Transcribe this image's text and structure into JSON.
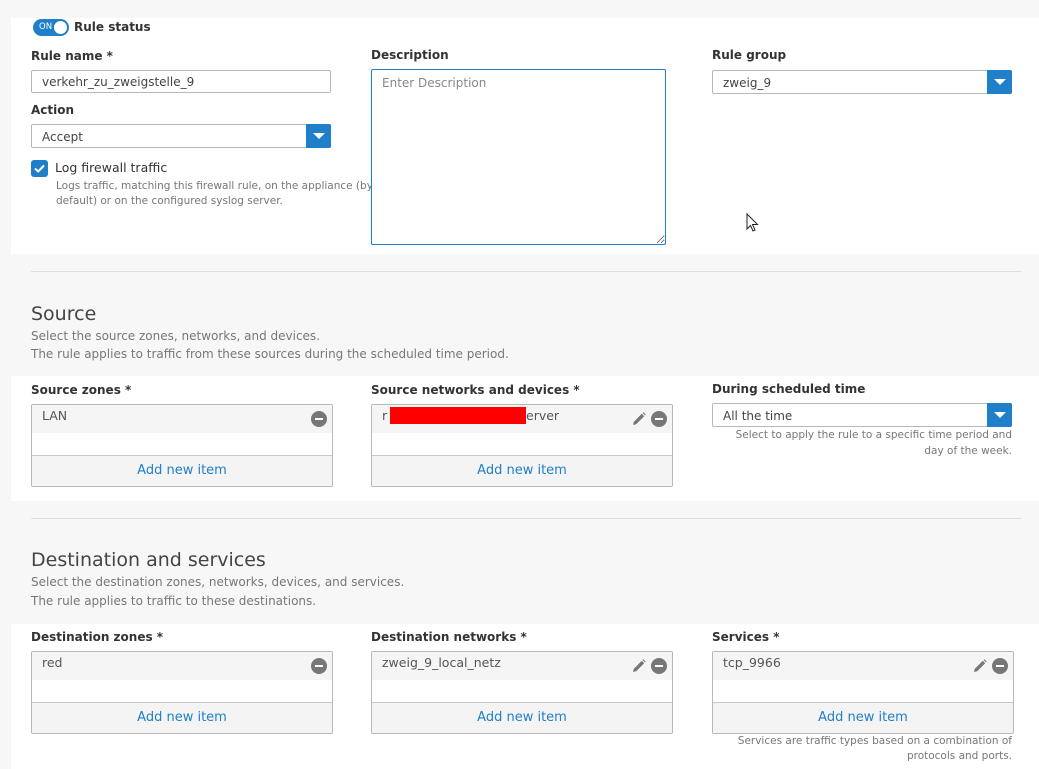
{
  "rule": {
    "status_toggle": "ON",
    "status_label": "Rule status",
    "name_label": "Rule name *",
    "name_value": "verkehr_zu_zweigstelle_9",
    "action_label": "Action",
    "action_value": "Accept",
    "log_label": "Log firewall traffic",
    "log_hint_line1": "Logs traffic, matching this firewall rule, on the appliance (by",
    "log_hint_line2": "default) or on the configured syslog server.",
    "description_label": "Description",
    "description_placeholder": "Enter Description",
    "group_label": "Rule group",
    "group_value": "zweig_9"
  },
  "source": {
    "title": "Source",
    "desc_line1": "Select the source zones, networks, and devices.",
    "desc_line2": "The rule applies to traffic from these sources during the scheduled time period.",
    "zones_label": "Source zones *",
    "zones_item": "LAN",
    "networks_label": "Source networks and devices *",
    "networks_item_start": "r",
    "networks_item_end": "erver",
    "schedule_label": "During scheduled time",
    "schedule_value": "All the time",
    "schedule_hint_line1": "Select to apply the rule to a specific time period and",
    "schedule_hint_line2": "day of the week."
  },
  "destination": {
    "title": "Destination and services",
    "desc_line1": "Select the destination zones, networks, devices, and services.",
    "desc_line2": "The rule applies to traffic to these destinations.",
    "zones_label": "Destination zones *",
    "zones_item": "red",
    "networks_label": "Destination networks *",
    "networks_item": "zweig_9_local_netz",
    "services_label": "Services *",
    "services_item": "tcp_9966",
    "services_hint_line1": "Services are traffic types based on a combination of",
    "services_hint_line2": "protocols and ports."
  },
  "common": {
    "add_new_item": "Add new item"
  },
  "colors": {
    "accent": "#1f7fc9",
    "redaction": "#ff0000"
  }
}
